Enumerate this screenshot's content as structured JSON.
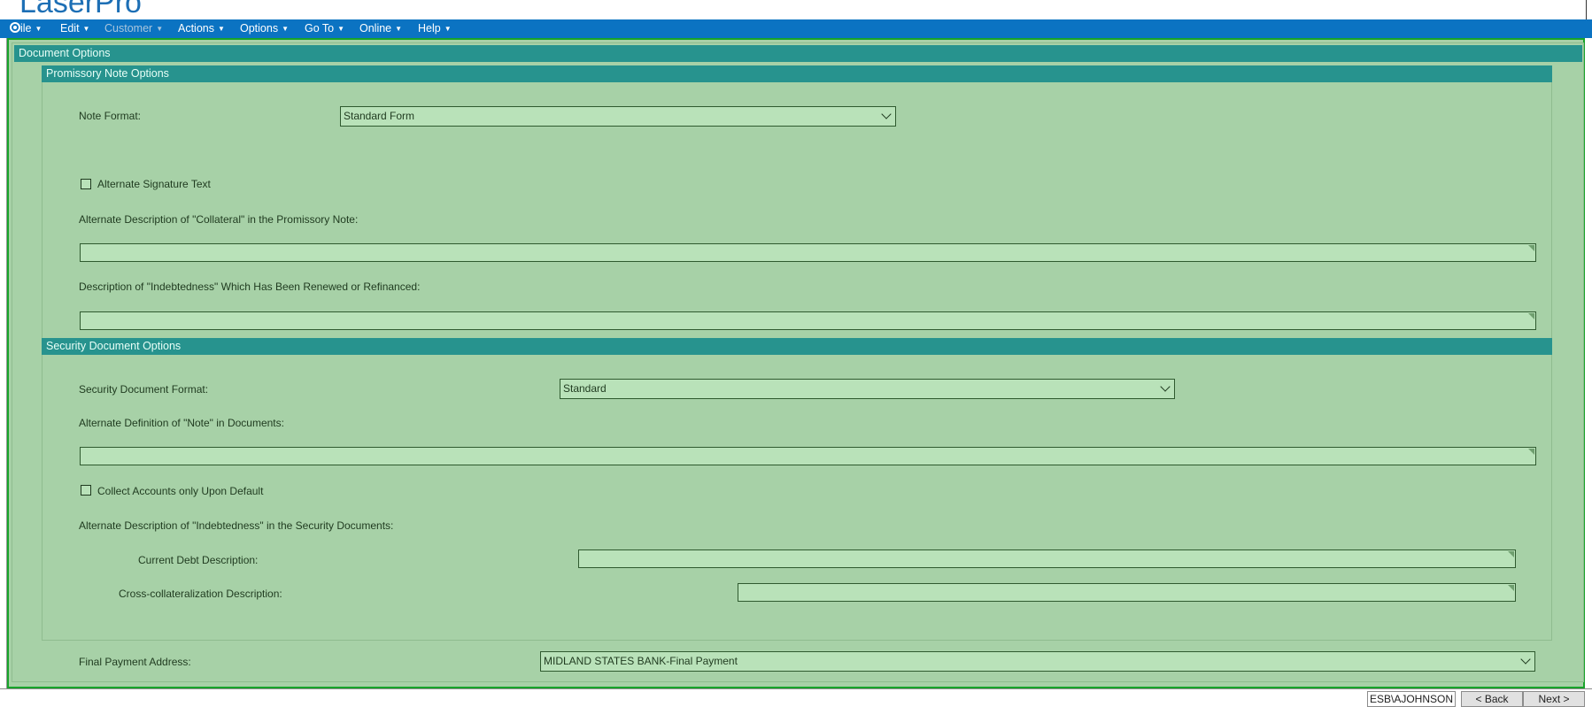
{
  "app": {
    "title": "LaserPro"
  },
  "menu": [
    {
      "label": "ile",
      "enabled": true
    },
    {
      "label": "Edit",
      "enabled": true
    },
    {
      "label": "Customer",
      "enabled": false
    },
    {
      "label": "Actions",
      "enabled": true
    },
    {
      "label": "Options",
      "enabled": true
    },
    {
      "label": "Go To",
      "enabled": true
    },
    {
      "label": "Online",
      "enabled": true
    },
    {
      "label": "Help",
      "enabled": true
    }
  ],
  "main": {
    "header": "Document Options",
    "promissory": {
      "header": "Promissory Note Options",
      "note_format_label": "Note Format:",
      "note_format_value": "Standard Form",
      "alt_signature_label": "Alternate Signature Text",
      "alt_signature_checked": false,
      "collateral_label": "Alternate Description of \"Collateral\" in the Promissory Note:",
      "collateral_value": "",
      "indebtedness_label": "Description of \"Indebtedness\" Which Has Been Renewed or Refinanced:",
      "indebtedness_value": ""
    },
    "security": {
      "header": "Security Document Options",
      "format_label": "Security Document Format:",
      "format_value": "Standard",
      "note_def_label": "Alternate Definition of \"Note\" in Documents:",
      "note_def_value": "",
      "collect_label": "Collect Accounts only Upon Default",
      "collect_checked": false,
      "alt_indebtedness_label": "Alternate Description of \"Indebtedness\" in the Security Documents:",
      "current_debt_label": "Current Debt Description:",
      "current_debt_value": "",
      "cross_collat_label": "Cross-collateralization Description:",
      "cross_collat_value": ""
    },
    "final_payment_label": "Final Payment Address:",
    "final_payment_value": "MIDLAND STATES BANK-Final Payment"
  },
  "status": {
    "user": "ESB\\AJOHNSON",
    "back_label": "< Back",
    "next_label": "Next >"
  },
  "colors": {
    "menubar": "#0b73c2",
    "panel": "#a7d1a7",
    "section_header": "#27938e",
    "frame_border": "#17a32a"
  }
}
